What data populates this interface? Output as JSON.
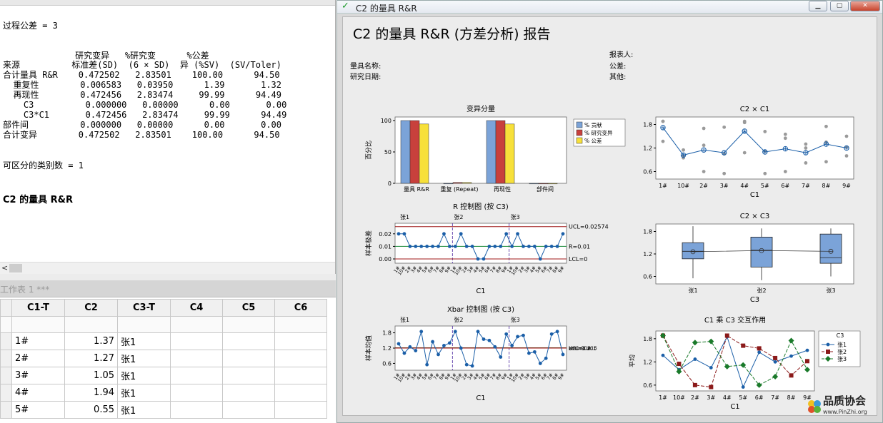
{
  "session": {
    "tolerance_line": "过程公差 = 3",
    "table_header_1": "              研究变异   %研究变      %公差",
    "table_header_2": "来源          标准差(SD)  (6 × SD)  异 (%SV)  (SV/Toler)",
    "rows": [
      "合计量具 R&R    0.472502   2.83501    100.00      94.50",
      "  重复性        0.006583   0.03950      1.39       1.32",
      "  再现性        0.472456   2.83474     99.99      94.49",
      "    C3          0.000000   0.00000      0.00       0.00",
      "    C3*C1       0.472456   2.83474     99.99      94.49",
      "部件间          0.000000   0.00000      0.00       0.00",
      "合计变异        0.472502   2.83501    100.00      94.50"
    ],
    "categories_line": "可区分的类别数 = 1",
    "section_title": "C2 的量具 R&R",
    "scroll_left": "<"
  },
  "worksheet": {
    "title": "工作表 1 ***",
    "columns": [
      "C1-T",
      "C2",
      "C3-T",
      "C4",
      "C5",
      "C6"
    ],
    "rows": [
      [
        "1#",
        "1.37",
        "张1"
      ],
      [
        "2#",
        "1.27",
        "张1"
      ],
      [
        "3#",
        "1.05",
        "张1"
      ],
      [
        "4#",
        "1.94",
        "张1"
      ],
      [
        "5#",
        "0.55",
        "张1"
      ]
    ]
  },
  "graph_window": {
    "title": "C2 的量具 R&R",
    "report_title": "C2 的量具 R&R (方差分析) 报告",
    "gauge_name_label": "量具名称:",
    "study_date_label": "研究日期:",
    "reporter_label": "报表人:",
    "tolerance_label": "公差:",
    "other_label": "其他:",
    "min_btn": "▁",
    "max_btn": "▢",
    "close_btn": "✕"
  },
  "colors": {
    "bar_contrib": "#7ba3d8",
    "bar_sv": "#c8403c",
    "bar_tol": "#f7e03a",
    "series_blue": "#1b5fa8",
    "series_red": "#8b1a1a",
    "series_green": "#1a7a2a",
    "ucl_line": "#a01818",
    "center_line": "#1a8a3a"
  },
  "chart_data": [
    {
      "type": "bar",
      "title": "变异分量",
      "ylabel": "百分比",
      "categories": [
        "量具 R&R",
        "重复 (Repeat)",
        "再现性",
        "部件间"
      ],
      "series": [
        {
          "name": "% 贡献",
          "values": [
            100,
            0.02,
            99.98,
            0
          ]
        },
        {
          "name": "% 研究变异",
          "values": [
            100,
            1.39,
            99.99,
            0
          ]
        },
        {
          "name": "% 公差",
          "values": [
            94.5,
            1.32,
            94.49,
            0
          ]
        }
      ],
      "ylim": [
        0,
        100
      ],
      "yticks": [
        "0",
        "50",
        "100"
      ]
    },
    {
      "type": "line",
      "title": "R 控制图 (按 C3)",
      "ylabel": "样本极差",
      "xlabel": "C1",
      "groups": [
        "张1",
        "张2",
        "张3"
      ],
      "values": [
        0.02,
        0.02,
        0.01,
        0.01,
        0.01,
        0.01,
        0.01,
        0.01,
        0.02,
        0.01,
        0.01,
        0.02,
        0.01,
        0.01,
        0.0,
        0.0,
        0.01,
        0.01,
        0.01,
        0.02,
        0.01,
        0.02,
        0.01,
        0.01,
        0.01,
        0.0,
        0.01,
        0.01,
        0.01,
        0.02
      ],
      "ucl": 0.02574,
      "center": 0.01,
      "lcl": 0,
      "ucl_label": "UCL=0.02574",
      "center_label": "R=0.01",
      "lcl_label": "LCL=0",
      "ylim": [
        0,
        0.025
      ],
      "yticks": [
        "0.00",
        "0.01",
        "0.02"
      ]
    },
    {
      "type": "line",
      "title": "Xbar 控制图 (按 C3)",
      "ylabel": "样本均值",
      "xlabel": "C1",
      "groups": [
        "张1",
        "张2",
        "张3"
      ],
      "values": [
        1.37,
        1.0,
        1.25,
        1.1,
        1.85,
        0.55,
        1.45,
        0.95,
        1.3,
        1.4,
        1.85,
        1.2,
        0.55,
        0.5,
        1.85,
        1.55,
        1.5,
        1.25,
        0.85,
        1.75,
        1.3,
        1.65,
        1.7,
        1.0,
        1.05,
        0.6,
        0.8,
        1.75,
        1.85,
        0.95
      ],
      "ucl": 1.215,
      "center": 1.208,
      "lcl": 1.201,
      "ucl_label": "UCL=1.215",
      "center_label": "X=1.208",
      "lcl_label": "LCL=1.201",
      "ylim": [
        0.5,
        1.9
      ],
      "yticks": [
        "0.6",
        "1.2",
        "1.8"
      ]
    },
    {
      "type": "scatter",
      "title": "C2 × C1",
      "xlabel": "C1",
      "categories": [
        "1#",
        "10#",
        "2#",
        "3#",
        "4#",
        "5#",
        "6#",
        "7#",
        "8#",
        "9#"
      ],
      "means": [
        1.72,
        1.02,
        1.15,
        1.08,
        1.63,
        1.1,
        1.18,
        1.08,
        1.3,
        1.2
      ],
      "ylim": [
        0.5,
        1.9
      ],
      "yticks": [
        "0.6",
        "1.2",
        "1.8"
      ]
    },
    {
      "type": "box",
      "title": "C2 × C3",
      "xlabel": "C3",
      "categories": [
        "张1",
        "张2",
        "张3"
      ],
      "boxes": [
        {
          "min": 0.55,
          "q1": 1.07,
          "median": 1.27,
          "q3": 1.5,
          "max": 1.94,
          "mean": 1.26
        },
        {
          "min": 0.5,
          "q1": 0.85,
          "median": 1.3,
          "q3": 1.65,
          "max": 1.88,
          "mean": 1.29
        },
        {
          "min": 0.6,
          "q1": 0.95,
          "median": 1.1,
          "q3": 1.73,
          "max": 1.88,
          "mean": 1.27
        }
      ],
      "ylim": [
        0.4,
        2.0
      ],
      "yticks": [
        "0.6",
        "1.2",
        "1.8"
      ]
    },
    {
      "type": "line",
      "title": "C1 乘 C3 交互作用",
      "ylabel": "平均",
      "xlabel": "C1",
      "categories": [
        "1#",
        "10#",
        "2#",
        "3#",
        "4#",
        "5#",
        "6#",
        "7#",
        "8#",
        "9#"
      ],
      "legend_title": "C3",
      "series": [
        {
          "name": "张1",
          "values": [
            1.37,
            1.0,
            1.27,
            1.05,
            1.85,
            0.55,
            1.45,
            1.2,
            1.35,
            1.5
          ]
        },
        {
          "name": "张2",
          "values": [
            1.88,
            1.15,
            0.6,
            0.55,
            1.88,
            1.62,
            1.55,
            1.3,
            0.85,
            1.22
          ]
        },
        {
          "name": "张3",
          "values": [
            1.88,
            0.95,
            1.7,
            1.73,
            1.08,
            1.12,
            0.6,
            0.82,
            1.75,
            1.0
          ]
        }
      ],
      "ylim": [
        0.45,
        2.0
      ],
      "yticks": [
        "0.6",
        "1.2",
        "1.8"
      ]
    }
  ],
  "watermark": {
    "brand": "品质协会",
    "url": "www.PinZhi.org"
  }
}
